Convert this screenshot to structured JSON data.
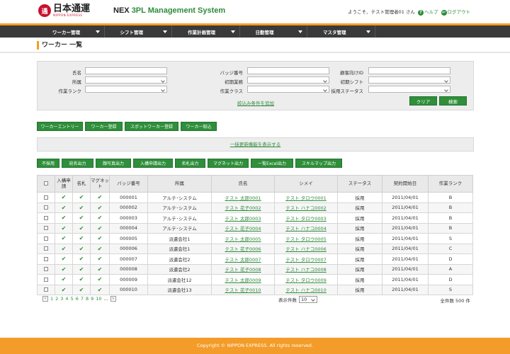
{
  "header": {
    "logo_mark": "通",
    "logo_jp": "日本通運",
    "logo_en": "NIPPON EXPRESS",
    "sys_nex": "NEX",
    "sys_rest": "3PL Management System",
    "welcome": "ようこそ、テスト管理者01 さん",
    "help": "ヘルプ",
    "logout": "ログアウト"
  },
  "nav": [
    "ワーカー管理",
    "シフト管理",
    "作業計画管理",
    "日勤管理",
    "マスタ管理"
  ],
  "page_title": "ワーカー 一覧",
  "search": {
    "name_label": "氏名",
    "affil_label": "所属",
    "rank_label": "作業ランク",
    "badge_label": "バッジ番号",
    "init_job_label": "初期業務",
    "work_class_label": "作業クラス",
    "client_id_label": "顧客向けID",
    "init_shift_label": "初期シフト",
    "emp_status_label": "採用ステータス",
    "add_condition": "絞込み条件を追加",
    "clear": "クリア",
    "search": "検索"
  },
  "actions1": [
    "ワーカーエントリー",
    "ワーカー登録",
    "スポットワーカー登録",
    "ワーカー取込"
  ],
  "bulk_link": "一括更新機能を表示する",
  "actions2": [
    "不採用",
    "宛名出力",
    "顔写真出力",
    "入構申請出力",
    "名札出力",
    "マグネット出力",
    "一覧Excel出力",
    "スキルマップ出力"
  ],
  "table": {
    "headers": [
      "入構申請",
      "名札",
      "マグネット",
      "バッジ番号",
      "所属",
      "氏名",
      "シメイ",
      "ステータス",
      "契約開始日",
      "作業ランク"
    ],
    "rows": [
      [
        "000001",
        "アルテ･システム",
        "テスト 太郎0001",
        "テスト タロウ0001",
        "採用",
        "2011/04/01",
        "B"
      ],
      [
        "000002",
        "アルテ･システム",
        "テスト 花子0002",
        "テスト ハナコ0002",
        "採用",
        "2011/04/01",
        "B"
      ],
      [
        "000003",
        "アルテ･システム",
        "テスト 太郎0003",
        "テスト タロウ0003",
        "採用",
        "2011/04/01",
        "B"
      ],
      [
        "000004",
        "アルテ･システム",
        "テスト 花子0004",
        "テスト ハナコ0004",
        "採用",
        "2011/04/01",
        "B"
      ],
      [
        "000005",
        "派遣会社1",
        "テスト 太郎0005",
        "テスト タロウ0005",
        "採用",
        "2011/04/01",
        "S"
      ],
      [
        "000006",
        "派遣会社1",
        "テスト 花子0006",
        "テスト ハナコ0006",
        "採用",
        "2011/04/01",
        "C"
      ],
      [
        "000007",
        "派遣会社2",
        "テスト 太郎0007",
        "テスト タロウ0007",
        "採用",
        "2011/04/01",
        "D"
      ],
      [
        "000008",
        "派遣会社2",
        "テスト 花子0008",
        "テスト ハナコ0008",
        "採用",
        "2011/04/01",
        "A"
      ],
      [
        "000009",
        "派遣会社12",
        "テスト 太郎0009",
        "テスト タロウ0009",
        "採用",
        "2011/04/01",
        "D"
      ],
      [
        "000010",
        "派遣会社13",
        "テスト 花子0010",
        "テスト ハナコ0010",
        "採用",
        "2011/04/01",
        "S"
      ]
    ]
  },
  "pager": {
    "prev": "<",
    "pages": [
      "1",
      "2",
      "3",
      "4",
      "5",
      "6",
      "7",
      "8",
      "9",
      "10"
    ],
    "more": "...",
    "next": ">",
    "per_page_label": "表示件数",
    "per_page": "10",
    "total": "全件数 500 件"
  },
  "footer": "Copyright © NIPPON EXPRESS. All rights reserved.",
  "colors": {
    "accent": "#f39c29",
    "green": "#2f8f3a",
    "nav": "#3a3a3a"
  }
}
